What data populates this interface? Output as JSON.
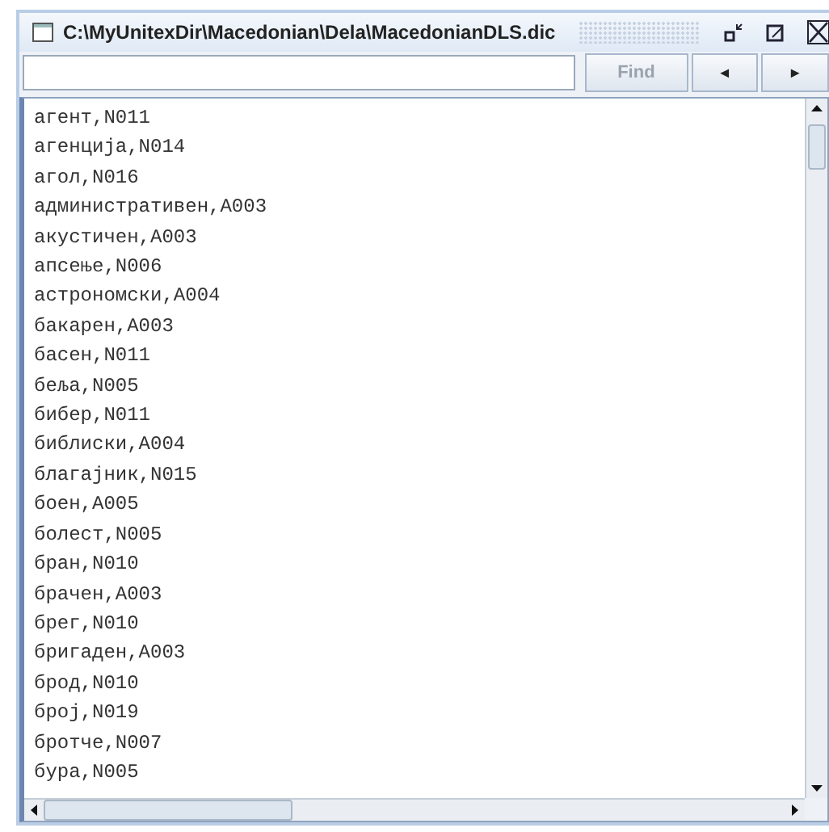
{
  "window": {
    "title": "C:\\MyUnitexDir\\Macedonian\\Dela\\MacedonianDLS.dic"
  },
  "toolbar": {
    "find_label": "Find",
    "previous": "◄",
    "next": "►"
  },
  "lines": [
    "агент,N011",
    "агенција,N014",
    "агол,N016",
    "административен,A003",
    "акустичен,A003",
    "апсење,N006",
    "астрономски,A004",
    "бакарен,A003",
    "басен,N011",
    "беља,N005",
    "бибер,N011",
    "библиски,A004",
    "благајник,N015",
    "боен,A005",
    "болест,N005",
    "бран,N010",
    "брачен,A003",
    "брег,N010",
    "бригаден,A003",
    "брод,N010",
    "број,N019",
    "бротче,N007",
    "бура,N005"
  ]
}
